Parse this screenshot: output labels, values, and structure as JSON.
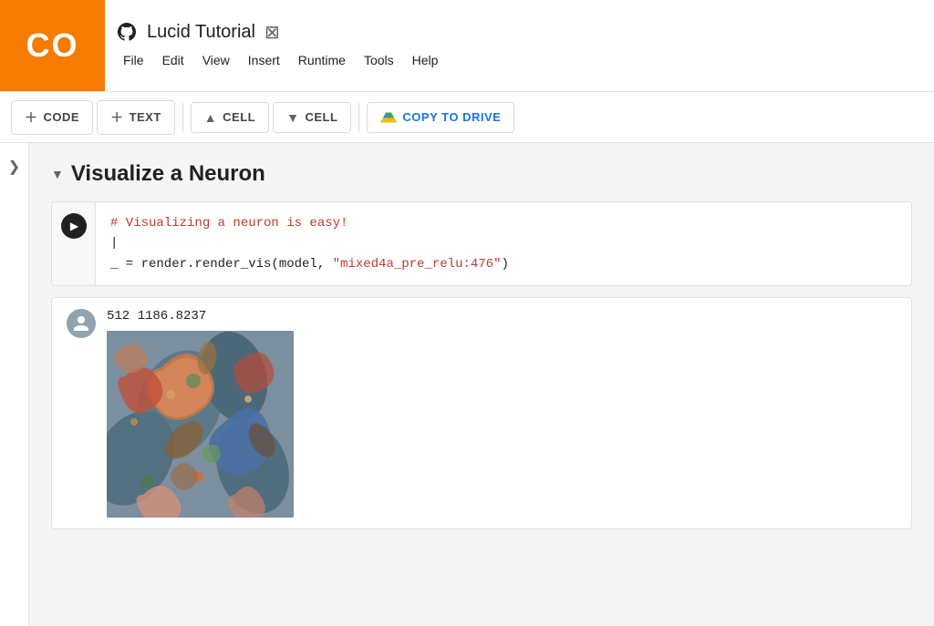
{
  "logo": {
    "text": "CO",
    "bg_color": "#f57c00"
  },
  "header": {
    "title": "Lucid Tutorial",
    "github_icon": "github-icon",
    "broken_image_icon": "⊠"
  },
  "menu": {
    "items": [
      "File",
      "Edit",
      "View",
      "Insert",
      "Runtime",
      "Tools",
      "Help"
    ]
  },
  "toolbar": {
    "buttons": [
      {
        "icon": "+",
        "label": "CODE"
      },
      {
        "icon": "+",
        "label": "TEXT"
      },
      {
        "icon": "↑",
        "label": "CELL"
      },
      {
        "icon": "↓",
        "label": "CELL"
      }
    ],
    "drive_button": {
      "icon": "drive",
      "label": "COPY TO DRIVE"
    }
  },
  "section": {
    "title": "Visualize a Neuron"
  },
  "code_cell": {
    "comment": "# Visualizing a neuron is easy!",
    "line2": "|",
    "code_prefix": "_ = render.render_vis(model, ",
    "code_string": "\"mixed4a_pre_relu:476\"",
    "code_suffix": ")"
  },
  "output": {
    "stats": "512  1186.8237"
  },
  "sidebar": {
    "toggle_arrow": "❯"
  }
}
